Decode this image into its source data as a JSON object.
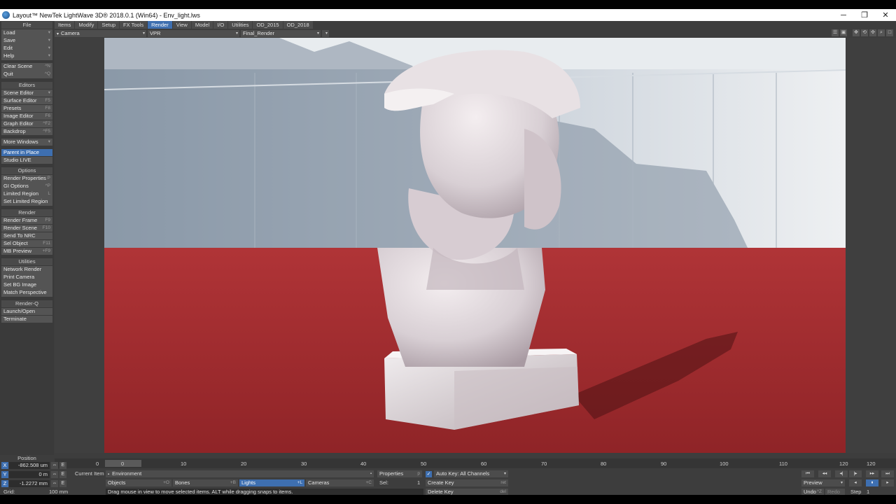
{
  "window": {
    "title": "Layout™ NewTek LightWave 3D® 2018.0.1 (Win64) - Env_light.lws",
    "minimize": "─",
    "restore": "❐",
    "close": "✕"
  },
  "left_panel": {
    "file_header": "File",
    "file_items": [
      {
        "label": "Load",
        "shortcut": "▾"
      },
      {
        "label": "Save",
        "shortcut": "▾"
      },
      {
        "label": "Edit",
        "shortcut": "▾"
      },
      {
        "label": "Help",
        "shortcut": "▾"
      }
    ],
    "clear_scene": {
      "label": "Clear Scene",
      "shortcut": "^N"
    },
    "quit": {
      "label": "Quit",
      "shortcut": "^Q"
    },
    "editors_header": "Editors",
    "editors_items": [
      {
        "label": "Scene Editor",
        "shortcut": "▾"
      },
      {
        "label": "Surface Editor",
        "shortcut": "F5"
      },
      {
        "label": "Presets",
        "shortcut": "F8"
      },
      {
        "label": "Image Editor",
        "shortcut": "F6"
      },
      {
        "label": "Graph Editor",
        "shortcut": "^F2"
      },
      {
        "label": "Backdrop",
        "shortcut": "^F5"
      }
    ],
    "more_windows": {
      "label": "More Windows",
      "shortcut": "▾"
    },
    "parent_in_place": "Parent in Place",
    "studio_live": "Studio LIVE",
    "options_header": "Options",
    "options_items": [
      {
        "label": "Render Properties",
        "shortcut": "P"
      },
      {
        "label": "GI Options",
        "shortcut": "^P"
      },
      {
        "label": "Limited Region",
        "shortcut": "L"
      },
      {
        "label": "Set Limited Region",
        "shortcut": ""
      }
    ],
    "render_header": "Render",
    "render_items": [
      {
        "label": "Render Frame",
        "shortcut": "F9"
      },
      {
        "label": "Render Scene",
        "shortcut": "F10"
      },
      {
        "label": "Send To NRC",
        "shortcut": ""
      },
      {
        "label": "Sel Object",
        "shortcut": "F11"
      },
      {
        "label": "MB Preview",
        "shortcut": "+F9"
      }
    ],
    "utilities_header": "Utilities",
    "utilities_items": [
      {
        "label": "Network Render",
        "shortcut": ""
      },
      {
        "label": "Print Camera",
        "shortcut": ""
      },
      {
        "label": "Set BG Image",
        "shortcut": ""
      },
      {
        "label": "Match Perspective",
        "shortcut": ""
      }
    ],
    "renderq_header": "Render-Q",
    "renderq_items": [
      {
        "label": "Launch/Open",
        "shortcut": ""
      },
      {
        "label": "Terminate",
        "shortcut": ""
      }
    ]
  },
  "tabs": [
    "Items",
    "Modify",
    "Setup",
    "FX Tools",
    "Render",
    "View",
    "Model",
    "I/O",
    "Utilities",
    "OD_2015",
    "OD_2018"
  ],
  "active_tab": "Render",
  "viewport": {
    "view_select": "Camera",
    "render_mode": "VPR",
    "render_preset": "Final_Render",
    "arrow": "▾"
  },
  "timeline": {
    "ticks": [
      "0",
      "10",
      "20",
      "30",
      "40",
      "50",
      "60",
      "70",
      "80",
      "90",
      "100",
      "110",
      "120"
    ],
    "start": "0",
    "end": "120",
    "current": "0"
  },
  "position": {
    "label": "Position",
    "x": {
      "axis": "X",
      "value": "-862.508 um"
    },
    "y": {
      "axis": "Y",
      "value": "0 m"
    },
    "z": {
      "axis": "Z",
      "value": "-1.2272 mm"
    },
    "grid_label": "Grid:",
    "grid_value": "100 mm",
    "lock_icon": "⇔",
    "e_label": "E"
  },
  "controls": {
    "current_item_label": "Current Item",
    "current_item": "Environment",
    "properties": "Properties",
    "properties_shortcut": "p",
    "auto_key": "Auto Key: All Channels",
    "sel_label": "Sel:",
    "sel_value": "1",
    "create_key": "Create Key",
    "create_key_shortcut": "ret",
    "delete_key": "Delete Key",
    "delete_key_shortcut": "del",
    "objects": "Objects",
    "objects_shortcut": "+O",
    "bones": "Bones",
    "bones_shortcut": "+B",
    "lights": "Lights",
    "lights_shortcut": "+L",
    "cameras": "Cameras",
    "cameras_shortcut": "+C",
    "status": "Drag mouse in view to move selected items. ALT while dragging snaps to items.",
    "preview": "Preview",
    "undo": "Undo",
    "undo_shortcut": "^Z",
    "redo": "Redo",
    "step_label": "Step",
    "step_value": "1"
  },
  "transport": [
    "⏮",
    "◂◂",
    "◂|",
    "|▸",
    "▸▸",
    "⏭"
  ],
  "playback": [
    "◂",
    "⏸",
    "▸"
  ]
}
